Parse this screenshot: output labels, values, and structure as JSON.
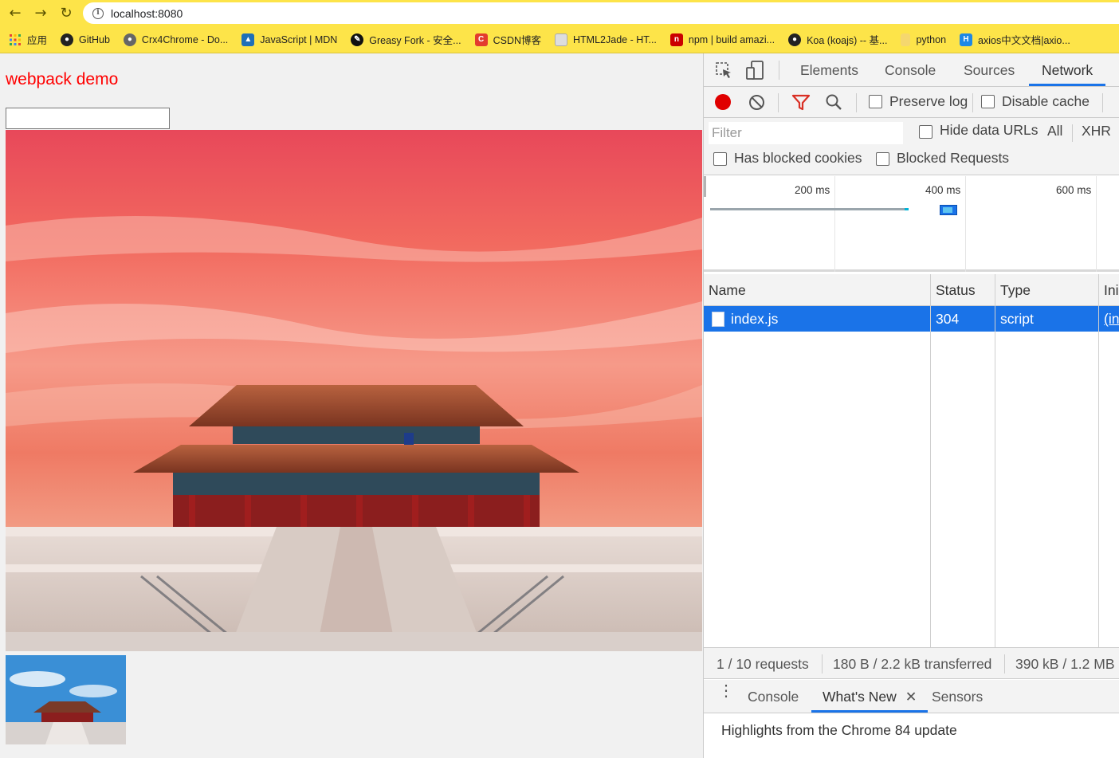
{
  "browser": {
    "url": "localhost:8080",
    "bookmarks": [
      {
        "label": "应用",
        "icon": "apps-grid-icon",
        "color": "#e94235"
      },
      {
        "label": "GitHub",
        "icon": "github-icon",
        "color": "#222222"
      },
      {
        "label": "Crx4Chrome - Do...",
        "icon": "crx4chrome-icon",
        "color": "#555555"
      },
      {
        "label": "JavaScript | MDN",
        "icon": "mdn-icon",
        "color": "#1e6fb8"
      },
      {
        "label": "Greasy Fork - 安全...",
        "icon": "greasyfork-icon",
        "color": "#111111"
      },
      {
        "label": "CSDN博客",
        "icon": "csdn-icon",
        "color": "#e33b2e"
      },
      {
        "label": "HTML2Jade - HT...",
        "icon": "page-icon",
        "color": "#dddddd"
      },
      {
        "label": "npm | build amazi...",
        "icon": "npm-icon",
        "color": "#cb0000"
      },
      {
        "label": "Koa (koajs) -- 基...",
        "icon": "koa-icon",
        "color": "#222222"
      },
      {
        "label": "python",
        "icon": "folder-icon",
        "color": "#f5d76e"
      },
      {
        "label": "axios中文文档|axio...",
        "icon": "axios-icon",
        "color": "#1e88e5"
      }
    ]
  },
  "page": {
    "title": "webpack demo",
    "input_value": ""
  },
  "devtools": {
    "tabs": [
      "Elements",
      "Console",
      "Sources",
      "Network"
    ],
    "active_tab": "Network",
    "toolbar": {
      "preserve_log": "Preserve log",
      "disable_cache": "Disable cache"
    },
    "filter": {
      "placeholder": "Filter",
      "hide_data_urls": "Hide data URLs",
      "all": "All",
      "xhr": "XHR",
      "has_blocked_cookies": "Has blocked cookies",
      "blocked_requests": "Blocked Requests"
    },
    "overview_ticks": [
      "200 ms",
      "400 ms",
      "600 ms"
    ],
    "table": {
      "headers": [
        "Name",
        "Status",
        "Type",
        "Ini"
      ],
      "rows": [
        {
          "name": "index.js",
          "status": "304",
          "type": "script",
          "initiator": "(in"
        }
      ]
    },
    "summary": {
      "requests": "1 / 10 requests",
      "transferred": "180 B / 2.2 kB transferred",
      "resources": "390 kB / 1.2 MB"
    },
    "drawer": {
      "tabs": [
        "Console",
        "What's New",
        "Sensors"
      ],
      "active_tab": "What's New",
      "content": "Highlights from the Chrome 84 update"
    },
    "colors": {
      "accent": "#1a73e8",
      "record": "#e00000",
      "filter": "#d93025"
    }
  }
}
